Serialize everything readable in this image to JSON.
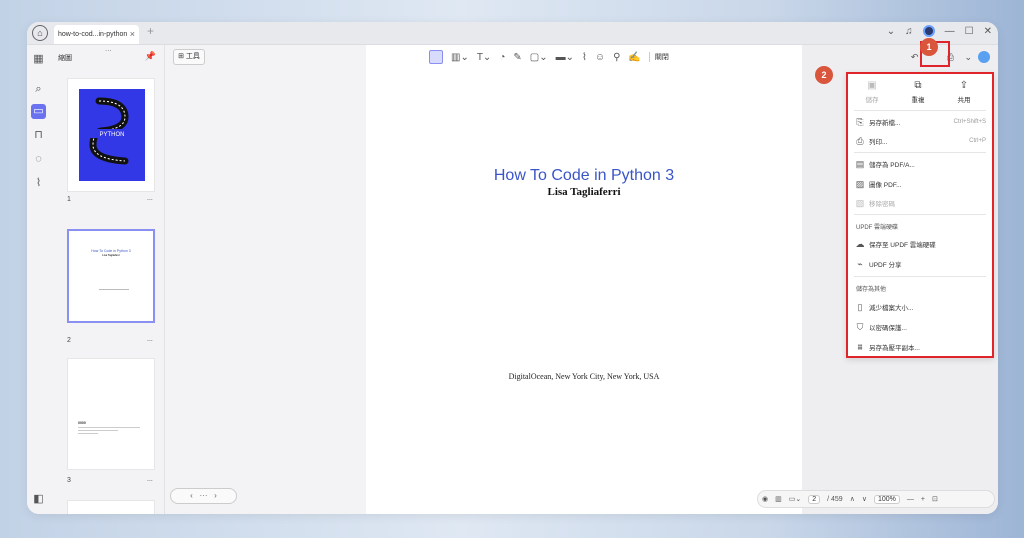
{
  "titlebar": {
    "tab_title": "how-to-cod...in-python",
    "close_glyph": "×",
    "new_tab_glyph": "+",
    "icons": [
      "chevron-down-icon",
      "bell-icon",
      "avatar",
      "minimize-icon",
      "maximize-icon",
      "close-icon"
    ]
  },
  "thumbnails": {
    "header": "縮圖",
    "dots": "...",
    "pages": [
      {
        "number": "1",
        "more": "...",
        "cover_text": "PYTHON"
      },
      {
        "number": "2",
        "more": "...",
        "title": "How To Code in Python 3",
        "subtitle": "Lisa Tagliaferri"
      },
      {
        "number": "3",
        "more": "...",
        "heading": "0000"
      }
    ]
  },
  "tools": {
    "label": "工具"
  },
  "toolbar": {
    "label": "關閉"
  },
  "document": {
    "title": "How To Code in Python 3",
    "author": "Lisa Tagliaferri",
    "publisher": "DigitalOcean, New York City, New York, USA"
  },
  "annotations": {
    "badge1": "1",
    "badge2": "2",
    "highlight_color": "#e0242c",
    "badge_color": "#d9553c"
  },
  "menu": {
    "top": [
      {
        "label": "儲存",
        "disabled": true
      },
      {
        "label": "重複",
        "disabled": false
      },
      {
        "label": "共用",
        "disabled": false
      }
    ],
    "items": [
      {
        "label": "另存新檔...",
        "shortcut": "Ctrl+Shift+S"
      },
      {
        "label": "列印...",
        "shortcut": "Ctrl+P"
      },
      {
        "label": "儲存為 PDF/A..."
      },
      {
        "label": "圖像 PDF..."
      },
      {
        "label": "移除密碼",
        "disabled": true
      }
    ],
    "cloud_section": "UPDF 雲端硬碟",
    "cloud_items": [
      {
        "label": "保存至 UPDF 雲端硬碟"
      },
      {
        "label": "UPDF 分享"
      }
    ],
    "other_section": "儲存為其他",
    "other_items": [
      {
        "label": "減少檔案大小..."
      },
      {
        "label": "以密碼保護..."
      },
      {
        "label": "另存為壓平副本..."
      }
    ]
  },
  "bottom": {
    "page": "2",
    "total": "/ 459",
    "zoom": "100%"
  },
  "colors": {
    "accent": "#6b72f0",
    "link_blue": "#3a55c8"
  }
}
